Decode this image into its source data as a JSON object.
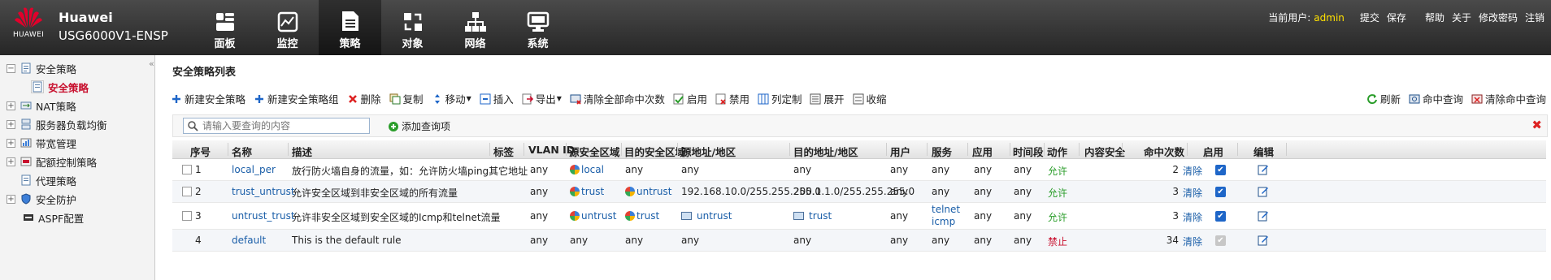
{
  "brand": {
    "logo_text": "HUAWEI",
    "vendor": "Huawei",
    "model": "USG6000V1-ENSP"
  },
  "nav": [
    {
      "label": "面板",
      "icon": "dashboard-icon"
    },
    {
      "label": "监控",
      "icon": "monitor-icon"
    },
    {
      "label": "策略",
      "icon": "policy-icon",
      "active": true
    },
    {
      "label": "对象",
      "icon": "object-icon"
    },
    {
      "label": "网络",
      "icon": "network-icon"
    },
    {
      "label": "系统",
      "icon": "system-icon"
    }
  ],
  "user_bar": {
    "current_user_label": "当前用户:",
    "username": "admin",
    "submit": "提交",
    "save": "保存",
    "help": "帮助",
    "about": "关于",
    "change_password": "修改密码",
    "logout": "注销"
  },
  "sidebar": {
    "items": [
      {
        "label": "安全策略",
        "expanded": true
      },
      {
        "label": "安全策略",
        "selected": true
      },
      {
        "label": "NAT策略"
      },
      {
        "label": "服务器负载均衡"
      },
      {
        "label": "带宽管理"
      },
      {
        "label": "配额控制策略"
      },
      {
        "label": "代理策略"
      },
      {
        "label": "安全防护"
      },
      {
        "label": "ASPF配置"
      }
    ]
  },
  "panel": {
    "title": "安全策略列表"
  },
  "toolbar": {
    "new_rule": "新建安全策略",
    "new_group": "新建安全策略组",
    "delete": "删除",
    "copy": "复制",
    "move": "移动",
    "insert": "插入",
    "export": "导出",
    "clear_all_hits": "清除全部命中次数",
    "enable": "启用",
    "disable": "禁用",
    "customize_columns": "列定制",
    "expand": "展开",
    "collapse": "收缩",
    "refresh": "刷新",
    "hit_query": "命中查询",
    "clear_hit_query": "清除命中查询"
  },
  "search": {
    "placeholder": "请输入要查询的内容",
    "add_query": "添加查询项"
  },
  "columns": {
    "seq": "序号",
    "name": "名称",
    "desc": "描述",
    "tag": "标签",
    "vlan": "VLAN ID",
    "src_zone": "源安全区域",
    "dst_zone": "目的安全区域",
    "src_addr": "源地址/地区",
    "dst_addr": "目的地址/地区",
    "user": "用户",
    "service": "服务",
    "app": "应用",
    "time": "时间段",
    "action": "动作",
    "content": "内容安全",
    "hits": "命中次数",
    "enabled": "启用",
    "edit": "编辑"
  },
  "rows": [
    {
      "seq": "1",
      "name": "local_per",
      "desc": "放行防火墙自身的流量，如：允许防火墙ping其它地址",
      "vlan": "any",
      "src_zone": "local",
      "dst_zone": "any",
      "src_addr": "any",
      "dst_addr": "any",
      "user": "any",
      "service": "any",
      "service2": "",
      "app": "any",
      "time": "any",
      "action": "允许",
      "action_type": "allow",
      "hits": "2",
      "clear": "清除",
      "enabled": true
    },
    {
      "seq": "2",
      "name": "trust_untrust",
      "desc": "允许安全区域到非安全区域的所有流量",
      "vlan": "any",
      "src_zone": "trust",
      "dst_zone": "untrust",
      "src_addr": "192.168.10.0/255.255.255.0",
      "dst_addr": "200.1.1.0/255.255.255.0",
      "user": "any",
      "service": "any",
      "service2": "",
      "app": "any",
      "time": "any",
      "action": "允许",
      "action_type": "allow",
      "hits": "3",
      "clear": "清除",
      "enabled": true
    },
    {
      "seq": "3",
      "name": "untrust_trust",
      "desc": "允许非安全区域到安全区域的Icmp和telnet流量",
      "vlan": "any",
      "src_zone": "untrust",
      "dst_zone": "trust",
      "src_addr": "untrust",
      "dst_addr": "trust",
      "user": "any",
      "service": "telnet",
      "service2": "icmp",
      "app": "any",
      "time": "any",
      "action": "允许",
      "action_type": "allow",
      "hits": "3",
      "clear": "清除",
      "enabled": true
    },
    {
      "seq": "4",
      "name": "default",
      "desc": "This is the default rule",
      "vlan": "any",
      "src_zone": "any",
      "dst_zone": "any",
      "src_addr": "any",
      "dst_addr": "any",
      "user": "any",
      "service": "any",
      "service2": "",
      "app": "any",
      "time": "any",
      "action": "禁止",
      "action_type": "deny",
      "hits": "34",
      "clear": "清除",
      "enabled": false
    }
  ],
  "colors": {
    "accent": "#1a5ea8",
    "allow": "#2a9d2a",
    "deny": "#c8102e",
    "highlight_user": "#ffe100"
  }
}
